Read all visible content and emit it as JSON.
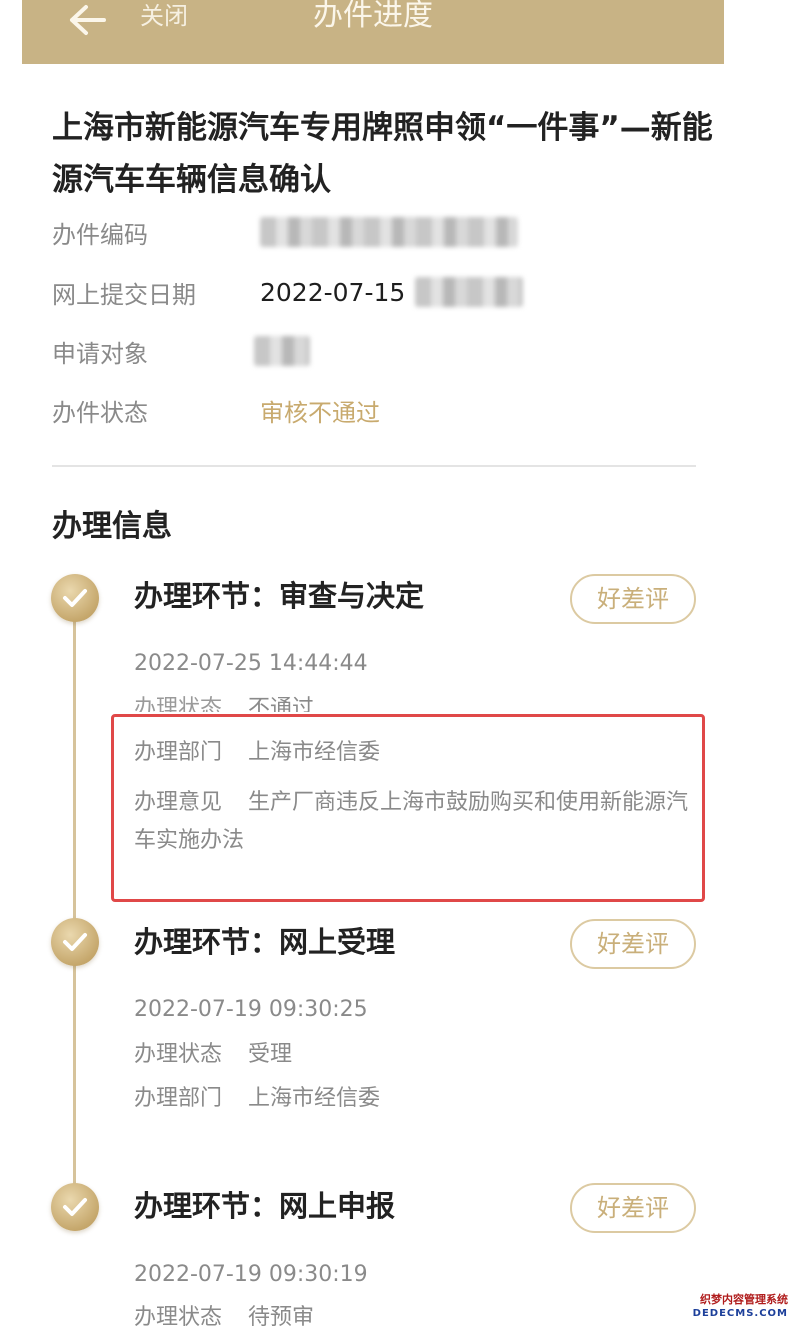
{
  "header": {
    "back_icon": "arrow-left-icon",
    "close_label": "关闭",
    "title": "办件进度"
  },
  "main_title": "上海市新能源汽车专用牌照申领“一件事”—新能源汽车车辆信息确认",
  "info": {
    "case_code_label": "办件编码",
    "submit_date_label": "网上提交日期",
    "submit_date_value": "2022-07-15",
    "applicant_label": "申请对象",
    "status_label": "办件状态",
    "status_value": "审核不通过",
    "status_color": "#c8aa6e"
  },
  "section_title": "办理信息",
  "steps": [
    {
      "title": "办理环节：审查与决定",
      "rate_label": "好差评",
      "time": "2022-07-25 14:44:44",
      "status_label": "办理状态",
      "status_value": "不通过",
      "dept_label": "办理部门",
      "dept_value": "上海市经信委",
      "opinion_label": "办理意见",
      "opinion_value": "生产厂商违反上海市鼓励购买和使用新能源汽车实施办法"
    },
    {
      "title": "办理环节：网上受理",
      "rate_label": "好差评",
      "time": "2022-07-19 09:30:25",
      "status_label": "办理状态",
      "status_value": "受理",
      "dept_label": "办理部门",
      "dept_value": "上海市经信委"
    },
    {
      "title": "办理环节：网上申报",
      "rate_label": "好差评",
      "time": "2022-07-19 09:30:19",
      "status_label": "办理状态",
      "status_value": "待预审"
    }
  ],
  "colors": {
    "header_bg": "#c8b385",
    "accent_gold": "#c9af7a",
    "highlight_red": "#e04848"
  },
  "watermark": {
    "line1": "织梦内容管理系统",
    "line2": "DEDECMS.COM"
  }
}
